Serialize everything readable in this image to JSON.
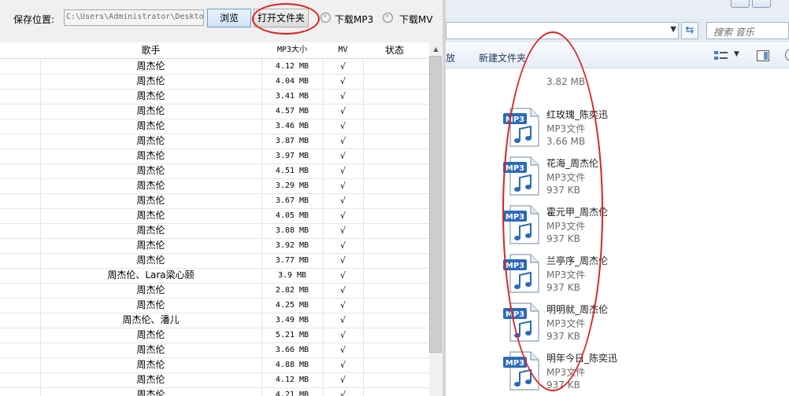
{
  "toolbar": {
    "save_location_label": "保存位置:",
    "save_path": "C:\\Users\\Administrator\\Desktop",
    "browse_label": "浏览",
    "open_folder_label": "打开文件夹",
    "download_mp3_label": "下载MP3",
    "download_mv_label": "下载MV"
  },
  "table": {
    "headers": {
      "singer": "歌手",
      "size": "MP3大小",
      "mv": "MV",
      "status": "状态"
    },
    "rows": [
      {
        "singer": "周杰伦",
        "size": "4.12 MB",
        "mv": "√"
      },
      {
        "singer": "周杰伦",
        "size": "4.04 MB",
        "mv": "√"
      },
      {
        "singer": "周杰伦",
        "size": "3.41 MB",
        "mv": "√"
      },
      {
        "singer": "周杰伦",
        "size": "4.57 MB",
        "mv": "√"
      },
      {
        "singer": "周杰伦",
        "size": "3.46 MB",
        "mv": "√"
      },
      {
        "singer": "周杰伦",
        "size": "3.87 MB",
        "mv": "√"
      },
      {
        "singer": "周杰伦",
        "size": "3.97 MB",
        "mv": "√"
      },
      {
        "singer": "周杰伦",
        "size": "4.51 MB",
        "mv": "√"
      },
      {
        "singer": "周杰伦",
        "size": "3.29 MB",
        "mv": "√"
      },
      {
        "singer": "周杰伦",
        "size": "3.67 MB",
        "mv": "√"
      },
      {
        "singer": "周杰伦",
        "size": "4.05 MB",
        "mv": "√"
      },
      {
        "singer": "周杰伦",
        "size": "3.88 MB",
        "mv": "√"
      },
      {
        "singer": "周杰伦",
        "size": "3.92 MB",
        "mv": "√"
      },
      {
        "singer": "周杰伦",
        "size": "3.77 MB",
        "mv": "√"
      },
      {
        "singer": "周杰伦、Lara梁心颐",
        "size": "3.9 MB",
        "mv": "√"
      },
      {
        "singer": "周杰伦",
        "size": "2.82 MB",
        "mv": "√"
      },
      {
        "singer": "周杰伦",
        "size": "4.25 MB",
        "mv": "√"
      },
      {
        "singer": "周杰伦、潘儿",
        "size": "3.49 MB",
        "mv": "√"
      },
      {
        "singer": "周杰伦",
        "size": "5.21 MB",
        "mv": "√"
      },
      {
        "singer": "周杰伦",
        "size": "3.66 MB",
        "mv": "√"
      },
      {
        "singer": "周杰伦",
        "size": "4.88 MB",
        "mv": "√"
      },
      {
        "singer": "周杰伦",
        "size": "4.12 MB",
        "mv": "√"
      },
      {
        "singer": "周杰伦",
        "size": "4.21 MB",
        "mv": "√"
      }
    ]
  },
  "explorer": {
    "search_placeholder": "搜索 音乐",
    "cmd_play_partial": "放",
    "cmd_new_folder": "新建文件夹",
    "top_partial_size": "3.82 MB",
    "files": [
      {
        "name": "红玫瑰_陈奕迅",
        "type": "MP3文件",
        "size": "3.66 MB"
      },
      {
        "name": "花海_周杰伦",
        "type": "MP3文件",
        "size": "937 KB"
      },
      {
        "name": "霍元甲_周杰伦",
        "type": "MP3文件",
        "size": "937 KB"
      },
      {
        "name": "兰亭序_周杰伦",
        "type": "MP3文件",
        "size": "937 KB"
      },
      {
        "name": "明明就_周杰伦",
        "type": "MP3文件",
        "size": "937 KB"
      },
      {
        "name": "明年今日_陈奕迅",
        "type": "MP3文件",
        "size": "937 KB"
      }
    ],
    "icon_badge": "MP3"
  },
  "colors": {
    "annotation": "#e02020",
    "icon_blue": "#2b6bb8",
    "selected_button": "#cfe3f5"
  }
}
